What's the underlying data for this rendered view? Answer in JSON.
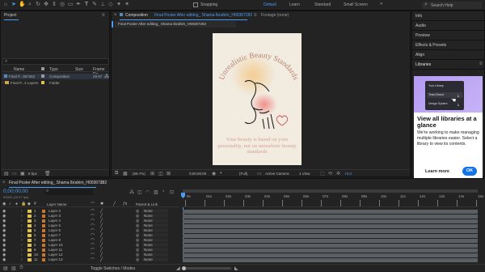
{
  "toolbar": {
    "snapping_label": "Snapping",
    "workspaces": [
      "Default",
      "Learn",
      "Standard",
      "Small Screen"
    ],
    "search_placeholder": "Search Help"
  },
  "project": {
    "tab_label": "Project",
    "columns": [
      "Name",
      "Type",
      "Size",
      "Frame Ra..."
    ],
    "items": [
      {
        "name": "Final P...367282",
        "type": "Composition",
        "frame_rate": "29.97"
      },
      {
        "name": "Final P...2 Layers",
        "type": "Folder",
        "frame_rate": ""
      }
    ],
    "bpc_label": "8 bpc"
  },
  "composition": {
    "tab_label": "Composition",
    "comp_name": "Final Poster After editing_ Shama Ibrahim_H00367282",
    "footage_label": "Footage (none)",
    "subtab_label": "Final Poster After editing_ Shama Ibrahim_H00367282",
    "footer": {
      "zoom": "(66.7%)",
      "timecode": "0;00;00;00",
      "resolution": "(Full)",
      "camera": "Active Camera",
      "views": "1 View",
      "exposure": "+0.0"
    }
  },
  "poster": {
    "title": "Unrealistic Beauty Standards",
    "tagline": "Your beauty is based on your personality, not on unrealistic beauty standards"
  },
  "right_panels": {
    "items": [
      "Info",
      "Audio",
      "Preview",
      "Effects & Presets",
      "Align",
      "Libraries"
    ],
    "libraries_promo": {
      "mini_rows": [
        "Your Library",
        "Team Brand",
        "Design System"
      ],
      "heading": "View all libraries at a glance",
      "body": "We're working to make managing multiple libraries easier. Select a library to view its contents.",
      "learn_more": "Learn more",
      "ok": "OK"
    }
  },
  "timeline": {
    "tab_label": "Final Poster After editing_ Shama Ibrahim_H00367282",
    "timecode": "0;00;00;00",
    "frames": "00000 (29.97 fps)",
    "columns": {
      "layer_name": "Layer Name",
      "parent": "Parent & Link"
    },
    "ruler": [
      "0s",
      "01s",
      "02s",
      "03s",
      "04s",
      "05s",
      "06s",
      "07s",
      "08s",
      "09s",
      "10s",
      "11s",
      "12s",
      "13s",
      "14s",
      "15s"
    ],
    "layers": [
      {
        "num": "1",
        "name": "Layer 2",
        "parent": "None"
      },
      {
        "num": "2",
        "name": "Layer 3",
        "parent": "None"
      },
      {
        "num": "3",
        "name": "Layer 4",
        "parent": "None"
      },
      {
        "num": "4",
        "name": "Layer 5",
        "parent": "None"
      },
      {
        "num": "5",
        "name": "Layer 6",
        "parent": "None"
      },
      {
        "num": "6",
        "name": "Layer 7",
        "parent": "None"
      },
      {
        "num": "7",
        "name": "Layer 8",
        "parent": "None"
      },
      {
        "num": "8",
        "name": "Layer 10",
        "parent": "None"
      },
      {
        "num": "9",
        "name": "Layer 11",
        "parent": "None"
      },
      {
        "num": "10",
        "name": "Layer 12",
        "parent": "None"
      },
      {
        "num": "11",
        "name": "Layer 13",
        "parent": "None"
      }
    ],
    "footer_label": "Toggle Switches / Modes"
  },
  "colors": {
    "accent": "#4b9cf0",
    "label_yellow": "#e1c047",
    "label_orange": "#c7772b",
    "poster_title": "#b5826d",
    "poster_text": "#d9a095"
  }
}
